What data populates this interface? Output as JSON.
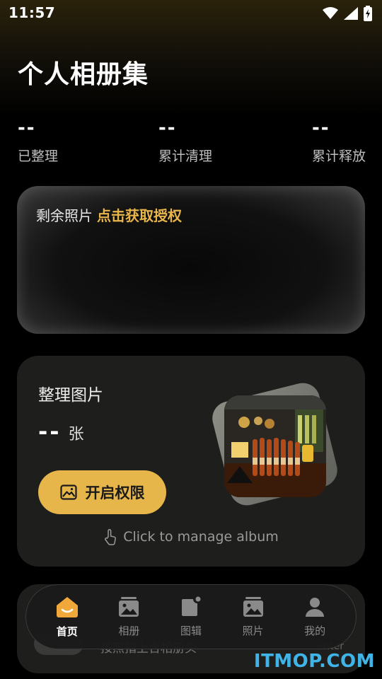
{
  "status_bar": {
    "time": "11:57"
  },
  "header": {
    "title": "个人相册集"
  },
  "stats": [
    {
      "value": "--",
      "label": "已整理"
    },
    {
      "value": "--",
      "label": "累计清理"
    },
    {
      "value": "--",
      "label": "累计释放"
    }
  ],
  "remain_card": {
    "title": "剩余照片",
    "action": "点击获取授权"
  },
  "organize_card": {
    "title": "整理图片",
    "count": "--",
    "unit": "张",
    "button_label": "开启权限",
    "hint": "Click to manage album"
  },
  "bottom_card": {
    "text": "按照指上合相册头",
    "right_text": "enter"
  },
  "tabs": [
    {
      "label": "首页",
      "icon": "home-icon",
      "active": true
    },
    {
      "label": "相册",
      "icon": "album-icon"
    },
    {
      "label": "图辑",
      "icon": "collection-icon"
    },
    {
      "label": "照片",
      "icon": "photo-icon"
    },
    {
      "label": "我的",
      "icon": "profile-icon"
    }
  ],
  "watermark": "ITMOP.COM",
  "colors": {
    "accent": "#e6b64a",
    "background": "#000000",
    "card": "#1e1e1c"
  }
}
